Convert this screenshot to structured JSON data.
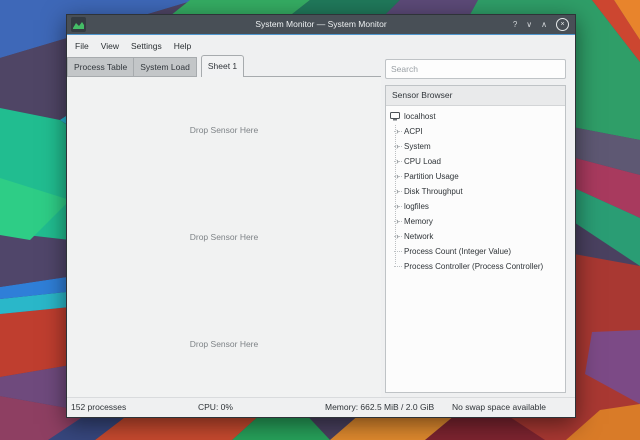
{
  "window": {
    "title": "System Monitor — System Monitor",
    "icons": {
      "help": "?",
      "minimize": "∨",
      "maximize": "∧",
      "close": "×"
    }
  },
  "menubar": {
    "items": [
      "File",
      "View",
      "Settings",
      "Help"
    ]
  },
  "tabs": {
    "items": [
      {
        "label": "Process Table",
        "active": false
      },
      {
        "label": "System Load",
        "active": false
      },
      {
        "label": "Sheet 1",
        "active": true
      }
    ]
  },
  "worksheet": {
    "cells": [
      "Drop Sensor Here",
      "Drop Sensor Here",
      "Drop Sensor Here"
    ]
  },
  "sidebar": {
    "search_placeholder": "Search",
    "header": "Sensor Browser",
    "expander_glyph": "›",
    "tree": [
      {
        "label": "localhost",
        "icon": "computer"
      },
      {
        "label": "ACPI",
        "expandable": true
      },
      {
        "label": "System",
        "expandable": true
      },
      {
        "label": "CPU Load",
        "expandable": true
      },
      {
        "label": "Partition Usage",
        "expandable": true
      },
      {
        "label": "Disk Throughput",
        "expandable": true
      },
      {
        "label": "logfiles",
        "expandable": true
      },
      {
        "label": "Memory",
        "expandable": true
      },
      {
        "label": "Network",
        "expandable": true
      },
      {
        "label": "Process Count (Integer Value)",
        "expandable": false
      },
      {
        "label": "Process Controller (Process Controller)",
        "expandable": false
      }
    ]
  },
  "statusbar": {
    "cells": [
      "152 processes",
      "CPU: 0%",
      "Memory: 662.5 MiB / 2.0 GiB",
      "No swap space available"
    ]
  },
  "theme": {
    "titlebar_bg": "#484f56",
    "accent_line": "#4f97cf",
    "window_bg": "#eff0f1",
    "list_bg": "#fcfcfc",
    "inactive_tab_bg": "#c3c6c8",
    "app_icon_green": "#44bd66"
  }
}
